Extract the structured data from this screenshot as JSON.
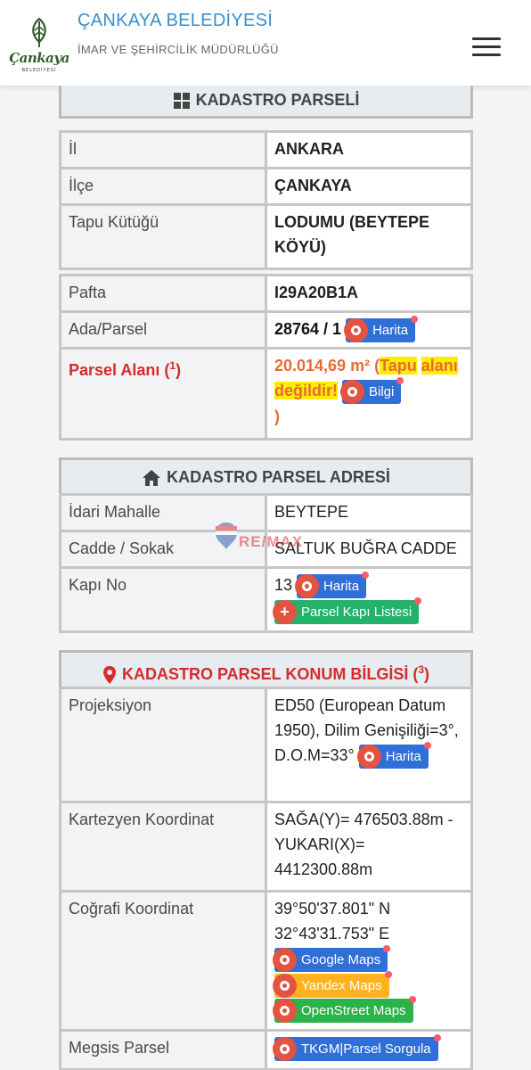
{
  "header": {
    "logo_text": "Çankaya",
    "logo_sub": "BELEDİYESİ",
    "title": "ÇANKAYA BELEDİYESİ",
    "subtitle": "İMAR VE ŞEHİRCİLİK MÜDÜRLÜĞÜ",
    "menu_icon": "hamburger-menu-icon"
  },
  "parcel": {
    "title": "KADASTRO PARSELİ",
    "il_label": "İl",
    "il_value": "ANKARA",
    "ilce_label": "İlçe",
    "ilce_value": "ÇANKAYA",
    "tapu_label": "Tapu Kütüğü",
    "tapu_value": "LODUMU (BEYTEPE KÖYÜ)",
    "pafta_label": "Pafta",
    "pafta_value": "I29A20B1A",
    "ada_label": "Ada/Parsel",
    "ada_value": "28764 / 1",
    "harita_button": "Harita",
    "alan_label": "Parsel Alanı (",
    "alan_sup": "1",
    "alan_close": ")",
    "alan_value": "20.014,69 m²",
    "alan_open_paren": " (",
    "alan_warning_1": "Tapu",
    "alan_warning_2": "alanı değildir!",
    "bilgi_button": "Bilgi",
    "alan_close_paren": ")"
  },
  "address": {
    "title": "KADASTRO PARSEL ADRESİ",
    "mahalle_label": "İdari Mahalle",
    "mahalle_value": "BEYTEPE",
    "sokak_label": "Cadde / Sokak",
    "sokak_value": "SALTUK BUĞRA CADDE",
    "kapi_label": "Kapı No",
    "kapi_value": "13",
    "harita_button": "Harita",
    "kapi_listesi_button": "Parsel Kapı Listesi"
  },
  "location": {
    "title": "KADASTRO PARSEL KONUM BİLGİSİ (",
    "title_sup": "3",
    "title_close": ")",
    "proj_label": "Projeksiyon",
    "proj_value": "ED50 (European Datum 1950), Dilim Genişiliği=3°, D.O.M=33°",
    "harita_button": "Harita",
    "kartezyen_label": "Kartezyen Koordinat",
    "kartezyen_value": "SAĞA(Y)= 476503.88m - YUKARI(X)= 4412300.88m",
    "cografi_label": "Coğrafi Koordinat",
    "cografi_n": "39°50'37.801\" N",
    "cografi_e": "32°43'31.753\" E",
    "google_button": "Google Maps",
    "yandex_button": "Yandex Maps",
    "osm_button": "OpenStreet Maps",
    "megsis_label": "Megsis Parsel",
    "tkgm_button": "TKGM|Parsel Sorgula"
  },
  "watermark": "RE/MAX",
  "colors": {
    "accent_blue": "#2f6fd7",
    "accent_green": "#22b26b",
    "warning_red": "#d62b2b",
    "value_orange": "#e76b34"
  }
}
